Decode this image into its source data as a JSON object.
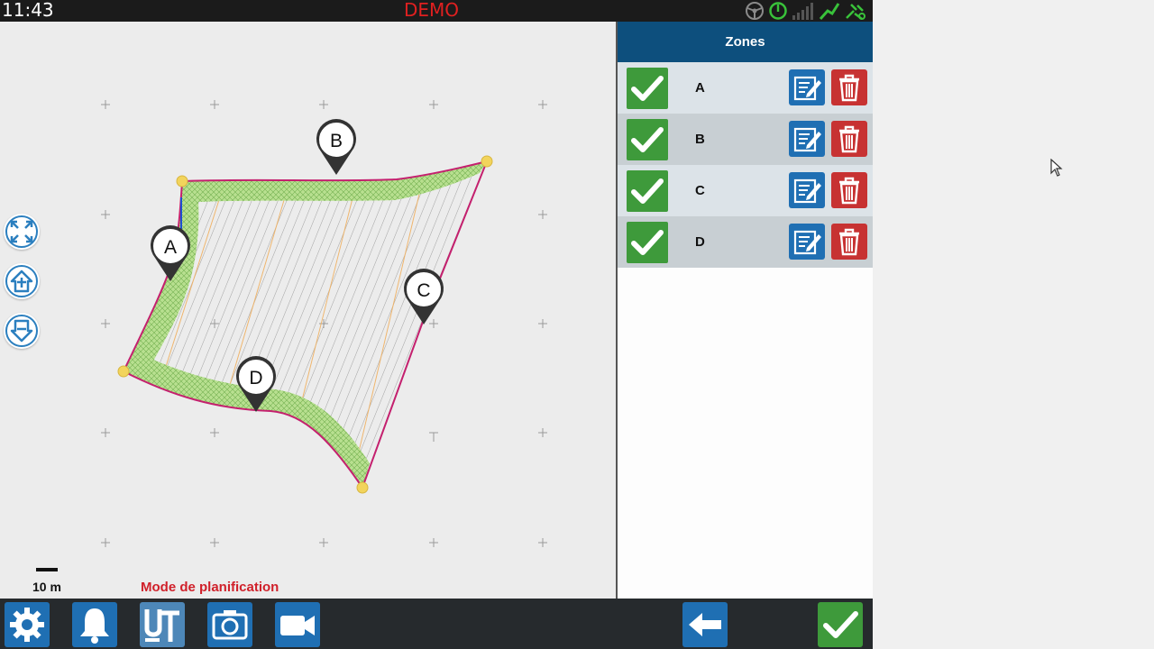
{
  "status": {
    "time": "11:43",
    "mode": "DEMO",
    "icons": [
      "steering-wheel-icon",
      "gauge-icon",
      "signal-bars-icon",
      "gnss-icon",
      "satellite-icon"
    ]
  },
  "map": {
    "scale_label": "10 m",
    "mode_label": "Mode de planification",
    "markers": [
      "A",
      "B",
      "C",
      "D"
    ],
    "controls": [
      "zoom-extent-icon",
      "home-up-icon",
      "home-down-icon"
    ]
  },
  "panel": {
    "title": "Zones",
    "zones": [
      {
        "name": "A",
        "enabled": true
      },
      {
        "name": "B",
        "enabled": true
      },
      {
        "name": "C",
        "enabled": true
      },
      {
        "name": "D",
        "enabled": true
      }
    ]
  },
  "toolbar": {
    "buttons": [
      "settings-icon",
      "bell-icon",
      "ut-icon",
      "camera-icon",
      "video-icon",
      "back-arrow-icon",
      "confirm-check-icon"
    ]
  },
  "colors": {
    "panel_header": "#0d4f7d",
    "check_green": "#3e9a3b",
    "edit_blue": "#1f6fb3",
    "delete_red": "#c73232",
    "mode_red": "#d0202a",
    "boundary": "#c4206e",
    "headland": "#b6e08c",
    "vertex": "#f2d45c"
  }
}
